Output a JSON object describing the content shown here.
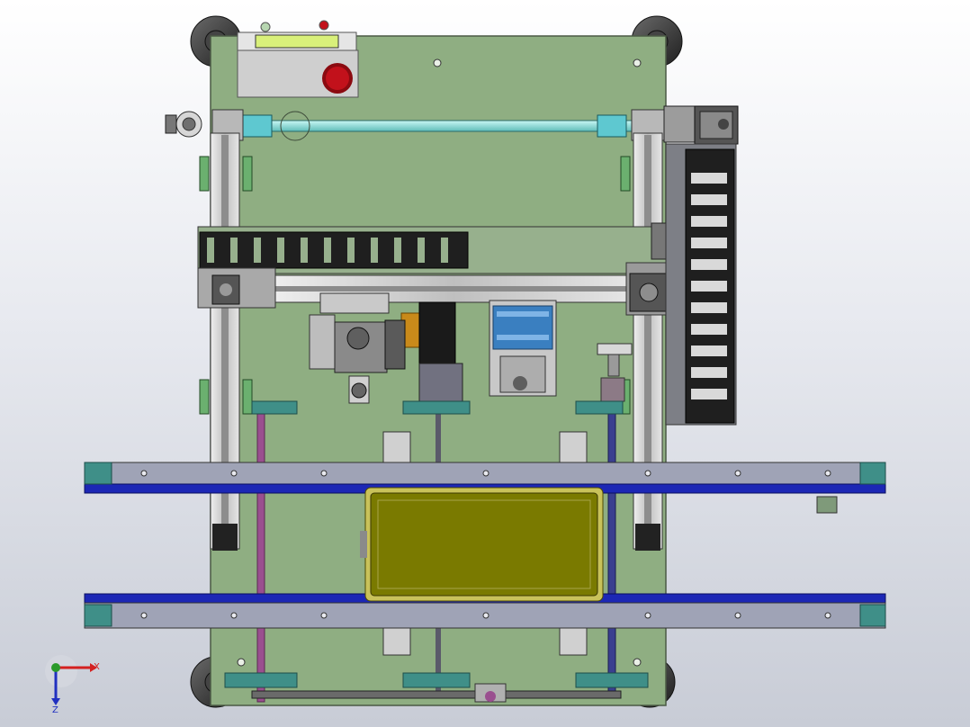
{
  "viewport": {
    "background_top": "#ffffff",
    "background_bottom": "#c8ccd6"
  },
  "colors": {
    "base_plate": "#8fae82",
    "base_plate_edge": "#4b5a45",
    "conveyor_rail": "#9fa3b6",
    "conveyor_belt": "#1c27b5",
    "conveyor_end": "#3f8f88",
    "tray": "#7a7a00",
    "tray_edge": "#c9c25a",
    "shaft": "#8fe3e0",
    "coupling": "#5ec8d0",
    "stop_button": "#c2111b",
    "lcd": "#d9f07a",
    "drag_chain": "#2b2b2b",
    "slide_rail": "#c7c7c7",
    "purple_rod": "#9a4f8f",
    "navy_rod": "#3a3f8f",
    "motor": "#6f6f74",
    "orange_block": "#c98a1a",
    "blue_part": "#3a7fc0"
  },
  "triad": {
    "x_label": "X",
    "z_label": "Z",
    "x_color": "#d42020",
    "y_color": "#2a9a2a",
    "z_color": "#2030c0"
  }
}
